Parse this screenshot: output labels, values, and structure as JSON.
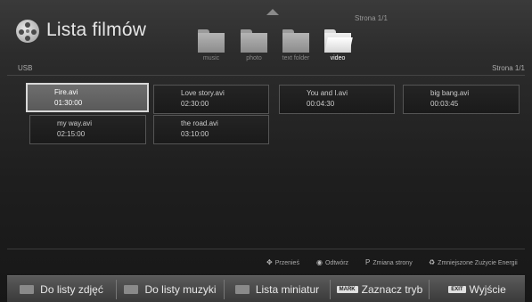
{
  "header": {
    "title": "Lista filmów",
    "source": "USB",
    "page_top": "Strona 1/1",
    "page_right": "Strona 1/1"
  },
  "folders": [
    {
      "label": "music"
    },
    {
      "label": "photo"
    },
    {
      "label": "text folder"
    },
    {
      "label": "video"
    }
  ],
  "files": [
    {
      "name": "Fire.avi",
      "duration": "01:30:00"
    },
    {
      "name": "Love story.avi",
      "duration": "02:30:00"
    },
    {
      "name": "You and I.avi",
      "duration": "00:04:30"
    },
    {
      "name": "big bang.avi",
      "duration": "00:03:45"
    },
    {
      "name": "my way.avi",
      "duration": "02:15:00"
    },
    {
      "name": "the road.avi",
      "duration": "03:10:00"
    }
  ],
  "hints": {
    "move": "Przenieś",
    "open": "Odtwórz",
    "page_change": "Zmiana strony",
    "energy": "Zmniejszone Zużycie Energii",
    "page_key": "P"
  },
  "bottom_bar": {
    "photos": "Do listy zdjęć",
    "music": "Do listy muzyki",
    "thumbs": "Lista miniatur",
    "mark_key": "MARK",
    "mark": "Zaznacz tryb",
    "exit_key": "EXIT",
    "exit": "Wyjście"
  }
}
